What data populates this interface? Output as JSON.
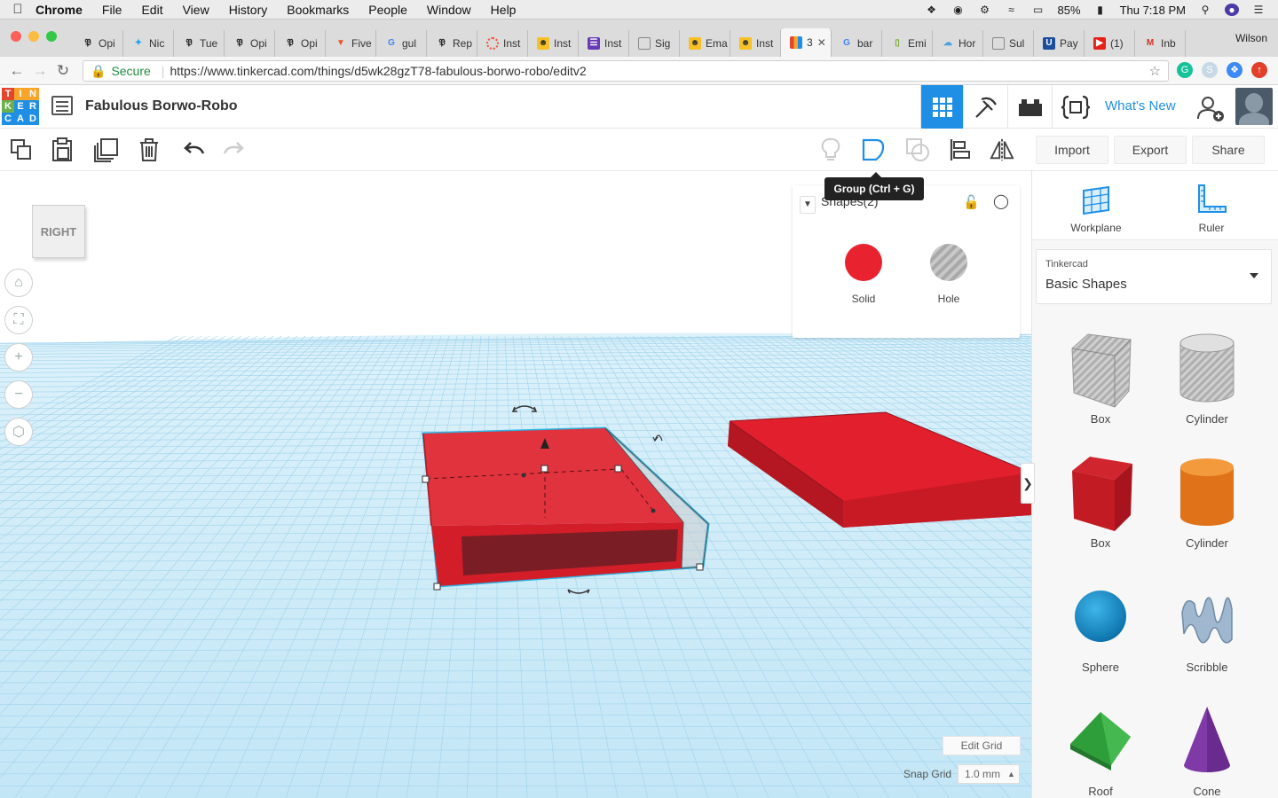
{
  "menubar": {
    "app": "Chrome",
    "items": [
      "File",
      "Edit",
      "View",
      "History",
      "Bookmarks",
      "People",
      "Window",
      "Help"
    ],
    "battery": "85%",
    "clock": "Thu 7:18 PM"
  },
  "tabs": [
    {
      "label": "Opi"
    },
    {
      "label": "Nic"
    },
    {
      "label": "Tue"
    },
    {
      "label": "Opi"
    },
    {
      "label": "Opi"
    },
    {
      "label": "Five"
    },
    {
      "label": "gul"
    },
    {
      "label": "Rep"
    },
    {
      "label": "Inst"
    },
    {
      "label": "Inst"
    },
    {
      "label": "Inst"
    },
    {
      "label": "Sig"
    },
    {
      "label": "Ema"
    },
    {
      "label": "Inst"
    },
    {
      "label": "3"
    },
    {
      "label": "bar"
    },
    {
      "label": "Emi"
    },
    {
      "label": "Hor"
    },
    {
      "label": "Sul"
    },
    {
      "label": "Pay"
    },
    {
      "label": "(1)"
    },
    {
      "label": "Inb"
    }
  ],
  "profile_name": "Wilson",
  "address": {
    "secure_label": "Secure",
    "url": "https://www.tinkercad.com/things/d5wk28gzT78-fabulous-borwo-robo/editv2"
  },
  "app": {
    "logo_letters": [
      "T",
      "I",
      "N",
      "K",
      "E",
      "R",
      "C",
      "A",
      "D"
    ],
    "title": "Fabulous Borwo-Robo",
    "whats_new": "What's New"
  },
  "toolbar": {
    "import": "Import",
    "export": "Export",
    "share": "Share",
    "tooltip": "Group (Ctrl + G)"
  },
  "viewcube": {
    "face": "RIGHT"
  },
  "shape_panel": {
    "title": "Shapes(2)",
    "solid": "Solid",
    "hole": "Hole",
    "solid_color": "#e8232f"
  },
  "library": {
    "workplane": "Workplane",
    "ruler": "Ruler",
    "category_label": "Tinkercad",
    "category_value": "Basic Shapes",
    "shapes": [
      "Box",
      "Cylinder",
      "Box",
      "Cylinder",
      "Sphere",
      "Scribble",
      "Roof",
      "Cone"
    ]
  },
  "grid": {
    "edit_label": "Edit Grid",
    "snap_label": "Snap Grid",
    "snap_value": "1.0 mm"
  },
  "colors": {
    "accent": "#1f8fe6",
    "shape_red": "#e8232f",
    "grid_blue": "#bfe3f3"
  }
}
